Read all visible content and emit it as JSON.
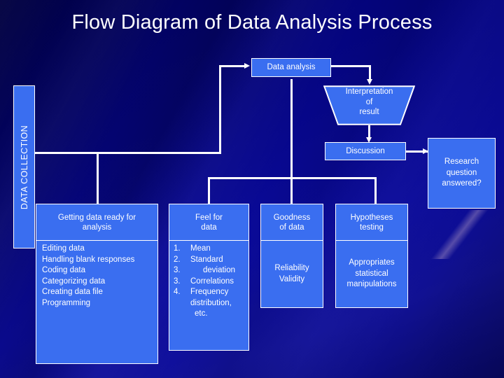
{
  "slide": {
    "title": "Flow Diagram of Data Analysis Process",
    "accent_box_color": "#3a6ef0",
    "background_color": "#000080",
    "line_color": "#ffffff"
  },
  "side_label": {
    "text": "DATA COLLECTION"
  },
  "nodes": {
    "data_analysis": "Data analysis",
    "interpretation": "Interpretation\nof\nresult",
    "interpretation_lines": [
      "Interpretation",
      "of",
      "result"
    ],
    "discussion": "Discussion",
    "research_question": "Research\nquestion\nanswered?",
    "research_question_lines": [
      "Research",
      "question",
      "answered?"
    ]
  },
  "columns": [
    {
      "id": "getting-data-ready",
      "header": "Getting data ready for analysis",
      "header_lines": [
        "Getting data ready for",
        "analysis"
      ],
      "items": [
        "Editing data",
        "Handling blank responses",
        "Coding data",
        "Categorizing data",
        "Creating data file",
        "Programming"
      ]
    },
    {
      "id": "feel-for-data",
      "header": "Feel for data",
      "header_lines": [
        "Feel for",
        "data"
      ],
      "numbered_items": [
        {
          "num": "1.",
          "text": "Mean"
        },
        {
          "num": "2.",
          "text": "Standard"
        },
        {
          "num": "3.",
          "text": "deviation"
        },
        {
          "num": "3.",
          "text": "Correlations"
        },
        {
          "num": "4.",
          "text": "Frequency"
        }
      ],
      "continuation_lines": [
        "distribution,",
        "etc."
      ]
    },
    {
      "id": "goodness-of-data",
      "header": "Goodness of data",
      "header_lines": [
        "Goodness",
        "of data"
      ],
      "body_lines": [
        "Reliability",
        "Validity"
      ]
    },
    {
      "id": "hypotheses-testing",
      "header": "Hypotheses testing",
      "header_lines": [
        "Hypotheses",
        "testing"
      ],
      "body_lines": [
        "Appropriates",
        "statistical",
        "manipulations"
      ]
    }
  ]
}
